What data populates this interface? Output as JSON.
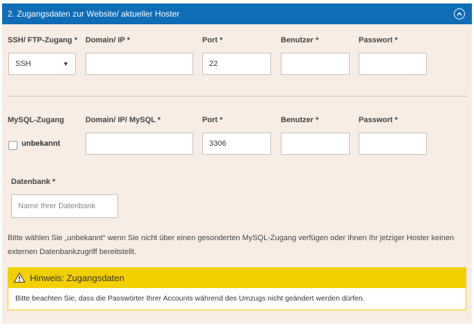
{
  "section": {
    "title": "2. Zugangsdaten zur Website/ aktueller Hoster",
    "collapse_icon": "chevron-up-circle-icon"
  },
  "ftp": {
    "label_access": "SSH/ FTP-Zugang *",
    "access_value": "SSH",
    "label_domain": "Domain/ IP *",
    "domain_value": "",
    "label_port": "Port *",
    "port_value": "22",
    "label_user": "Benutzer *",
    "user_value": "",
    "label_password": "Passwort *",
    "password_value": ""
  },
  "mysql": {
    "label_access": "MySQL-Zugang",
    "checkbox_label": "unbekannt",
    "checkbox_checked": false,
    "label_domain": "Domain/ IP/ MySQL *",
    "domain_value": "",
    "label_port": "Port *",
    "port_value": "3306",
    "label_user": "Benutzer *",
    "user_value": "",
    "label_password": "Passwort *",
    "password_value": ""
  },
  "database": {
    "label": "Datenbank *",
    "placeholder": "Name Ihrer Datenbank"
  },
  "info_text": "Bitte wählen Sie „unbekannt“ wenn Sie nicht über einen gesonderten MySQL-Zugang verfügen oder Ihnen Ihr jetziger Hoster keinen externen Datenbankzugriff bereitstellt.",
  "notice": {
    "icon": "warning-icon",
    "title": "Hinweis: Zugangsdaten",
    "body": "Bitte beachten Sie, dass die Passwörter Ihrer Accounts während des Umzugs nicht geändert werden dürfen."
  },
  "colors": {
    "header": "#0f6cb7",
    "panel": "#f8ede4",
    "notice": "#f2d000"
  }
}
